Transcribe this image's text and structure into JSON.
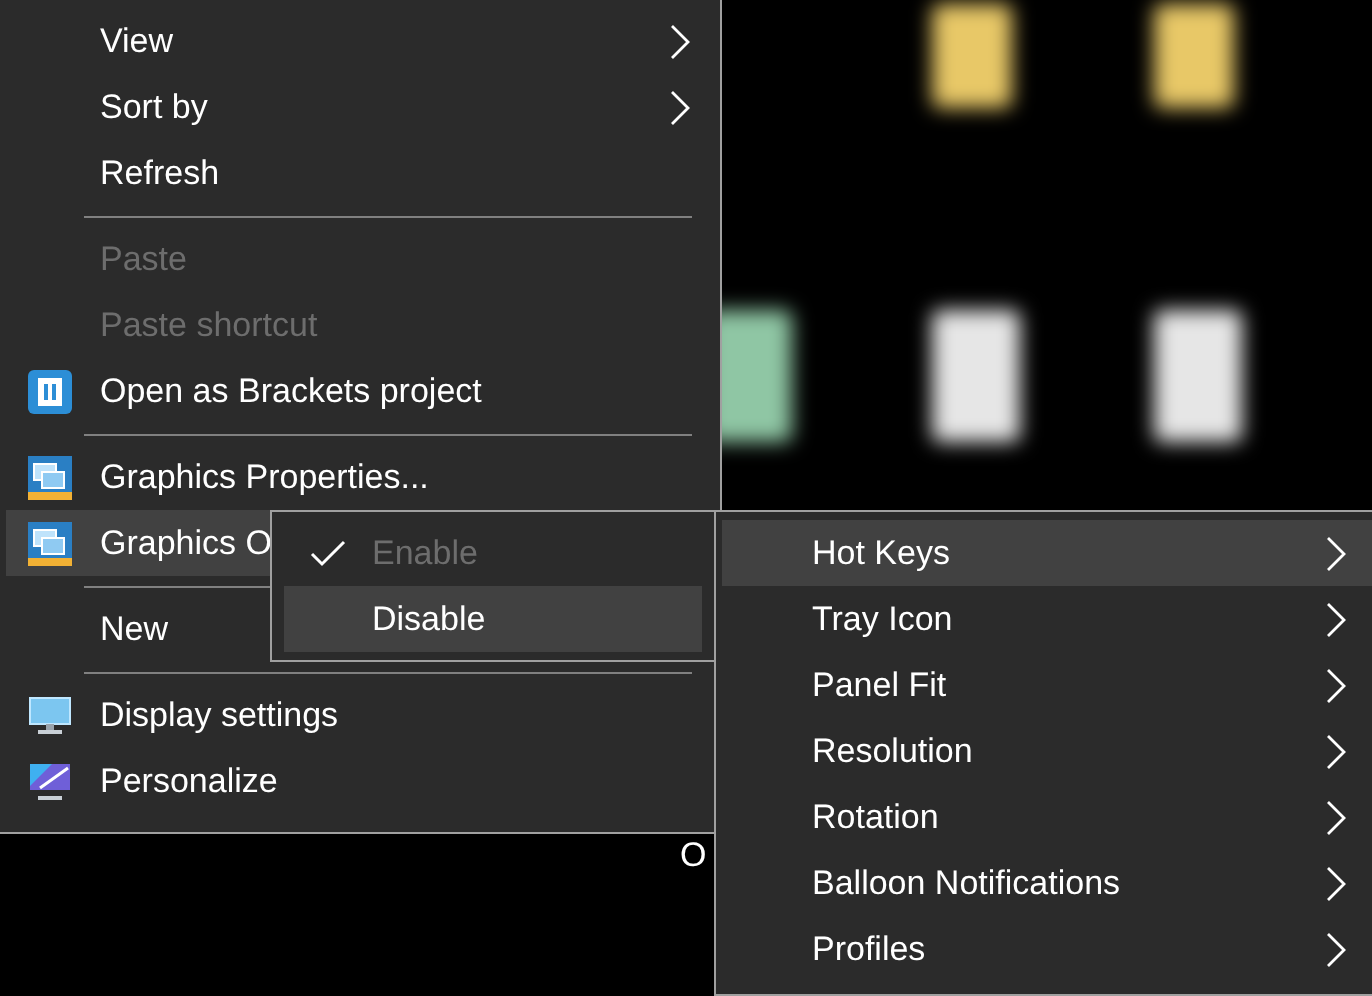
{
  "desktop": {
    "label_fragment": "O"
  },
  "context_menu": {
    "items": [
      {
        "kind": "item",
        "label": "View",
        "disabled": false,
        "submenu": true,
        "selected": false
      },
      {
        "kind": "item",
        "label": "Sort by",
        "disabled": false,
        "submenu": true,
        "selected": false
      },
      {
        "kind": "item",
        "label": "Refresh",
        "disabled": false,
        "submenu": false,
        "selected": false
      },
      {
        "kind": "separator"
      },
      {
        "kind": "item",
        "label": "Paste",
        "disabled": true,
        "submenu": false,
        "selected": false
      },
      {
        "kind": "item",
        "label": "Paste shortcut",
        "disabled": true,
        "submenu": false,
        "selected": false
      },
      {
        "kind": "brackets",
        "label": "Open as Brackets project",
        "disabled": false,
        "submenu": false,
        "selected": false
      },
      {
        "kind": "separator"
      },
      {
        "kind": "graphics",
        "label": "Graphics Properties...",
        "disabled": false,
        "submenu": false,
        "selected": false
      },
      {
        "kind": "graphics",
        "label": "Graphics O",
        "disabled": false,
        "submenu": false,
        "selected": true
      },
      {
        "kind": "separator"
      },
      {
        "kind": "item",
        "label": "New",
        "disabled": false,
        "submenu": false,
        "selected": false
      },
      {
        "kind": "separator"
      },
      {
        "kind": "display",
        "label": "Display settings",
        "disabled": false,
        "submenu": false,
        "selected": false
      },
      {
        "kind": "personalize",
        "label": "Personalize",
        "disabled": false,
        "submenu": false,
        "selected": false
      }
    ]
  },
  "toggle_menu": {
    "items": [
      {
        "label": "Enable",
        "checked": true,
        "disabled": true,
        "selected": false
      },
      {
        "label": "Disable",
        "checked": false,
        "disabled": false,
        "selected": true
      }
    ]
  },
  "options_menu": {
    "items": [
      {
        "label": "Hot Keys",
        "submenu": true,
        "selected": true
      },
      {
        "label": "Tray Icon",
        "submenu": true,
        "selected": false
      },
      {
        "label": "Panel Fit",
        "submenu": true,
        "selected": false
      },
      {
        "label": "Resolution",
        "submenu": true,
        "selected": false
      },
      {
        "label": "Rotation",
        "submenu": true,
        "selected": false
      },
      {
        "label": "Balloon Notifications",
        "submenu": true,
        "selected": false
      },
      {
        "label": "Profiles",
        "submenu": true,
        "selected": false
      }
    ]
  }
}
